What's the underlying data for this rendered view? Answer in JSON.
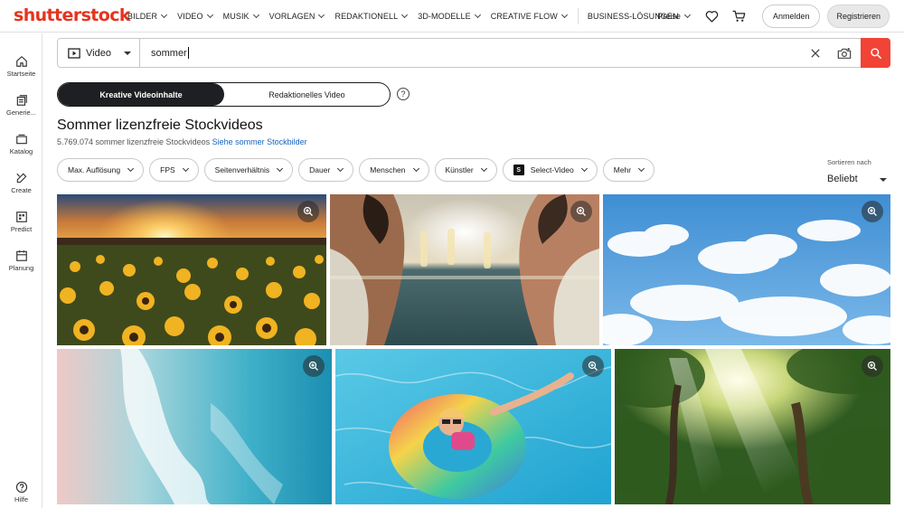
{
  "brand": {
    "logo_text": "shutterstock",
    "accent": "#f14336"
  },
  "nav": {
    "links": [
      {
        "label": "BILDER",
        "dropdown": true
      },
      {
        "label": "VIDEO",
        "dropdown": true
      },
      {
        "label": "MUSIK",
        "dropdown": true
      },
      {
        "label": "VORLAGEN",
        "dropdown": true
      },
      {
        "label": "REDAKTIONELL",
        "dropdown": true
      },
      {
        "label": "3D-MODELLE",
        "dropdown": true
      },
      {
        "label": "CREATIVE FLOW",
        "dropdown": true
      }
    ],
    "business": "BUSINESS-LÖSUNGEN",
    "pricing": "Preise",
    "login": "Anmelden",
    "register": "Registrieren",
    "icons": [
      "heart-icon",
      "cart-icon"
    ]
  },
  "sidebar": {
    "items": [
      {
        "label": "Startseite",
        "icon": "home-icon"
      },
      {
        "label": "Generie...",
        "icon": "generate-icon"
      },
      {
        "label": "Katalog",
        "icon": "catalog-icon"
      },
      {
        "label": "Create",
        "icon": "create-icon"
      },
      {
        "label": "Predict",
        "icon": "predict-icon"
      },
      {
        "label": "Planung",
        "icon": "planning-icon"
      }
    ],
    "help": "Hilfe"
  },
  "search": {
    "media_type": "Video",
    "query": "sommer"
  },
  "content_toggle": {
    "active": "Kreative Videoinhalte",
    "inactive": "Redaktionelles Video"
  },
  "results": {
    "title": "Sommer lizenzfreie Stockvideos",
    "count_text": "5.769.074 sommer lizenzfreie Stockvideos",
    "link_text": "Siehe sommer Stockbilder"
  },
  "filters": [
    {
      "label": "Max. Auflösung"
    },
    {
      "label": "FPS"
    },
    {
      "label": "Seitenverhältnis"
    },
    {
      "label": "Dauer"
    },
    {
      "label": "Menschen"
    },
    {
      "label": "Künstler"
    },
    {
      "label": "Select-Video",
      "badge": "S"
    },
    {
      "label": "Mehr"
    }
  ],
  "sort": {
    "label": "Sortieren nach",
    "value": "Beliebt"
  },
  "thumbnails": [
    {
      "name": "sunflower-field-sunset"
    },
    {
      "name": "friends-toasting-champagne"
    },
    {
      "name": "blue-sky-clouds"
    },
    {
      "name": "ocean-waves-aerial"
    },
    {
      "name": "child-pool-float"
    },
    {
      "name": "forest-sunbeams"
    }
  ]
}
